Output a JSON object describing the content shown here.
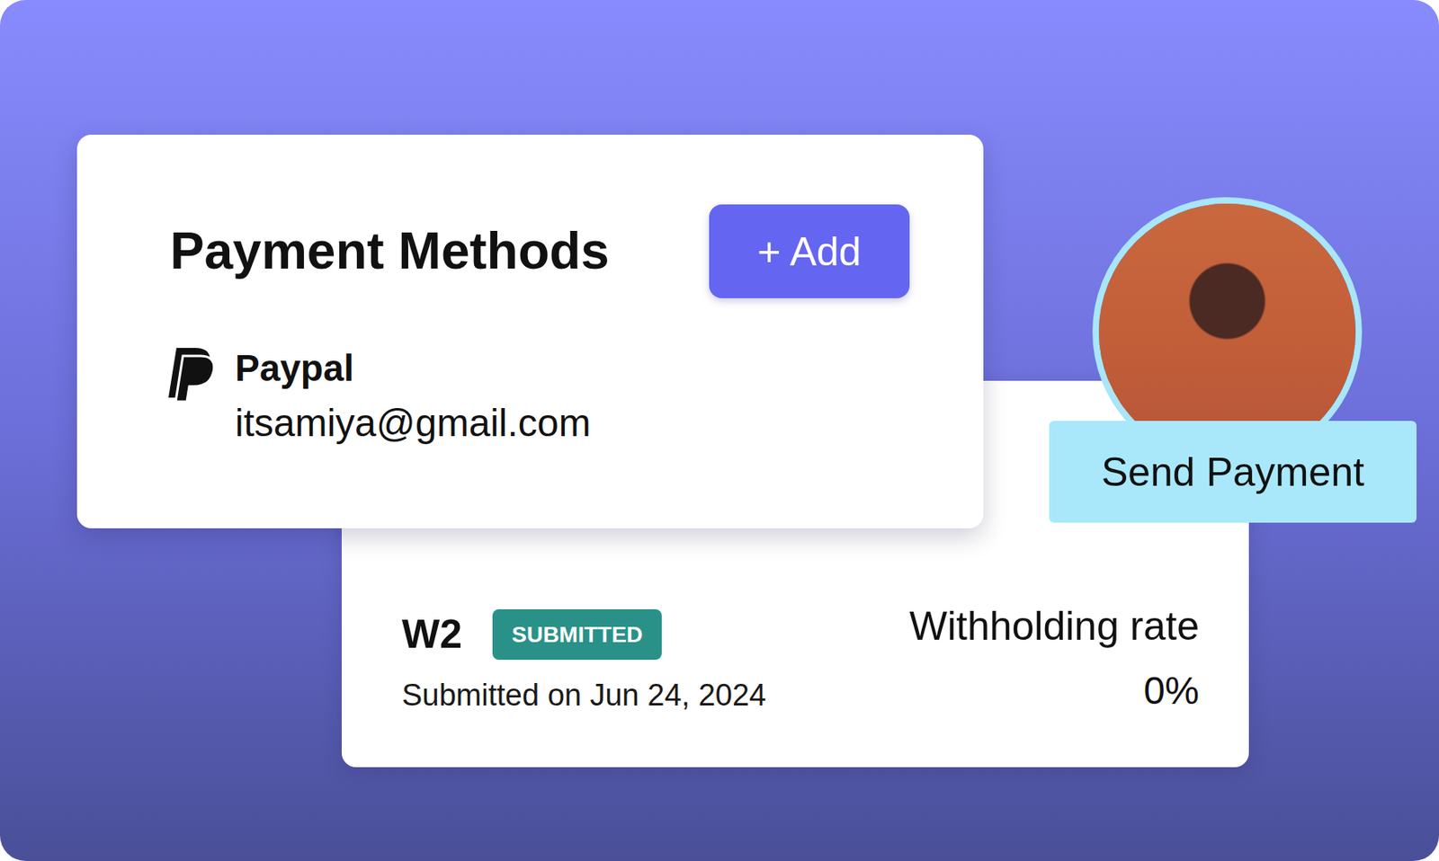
{
  "payment_methods": {
    "title": "Payment Methods",
    "add_button": "+ Add",
    "methods": [
      {
        "name": "Paypal",
        "account": "itsamiya@gmail.com"
      }
    ]
  },
  "tax_form": {
    "form": "W2",
    "status": "SUBMITTED",
    "submitted": "Submitted on Jun 24, 2024",
    "withholding_label": "Withholding rate",
    "withholding_value": "0%"
  },
  "profile": {
    "action": "Send Payment"
  }
}
